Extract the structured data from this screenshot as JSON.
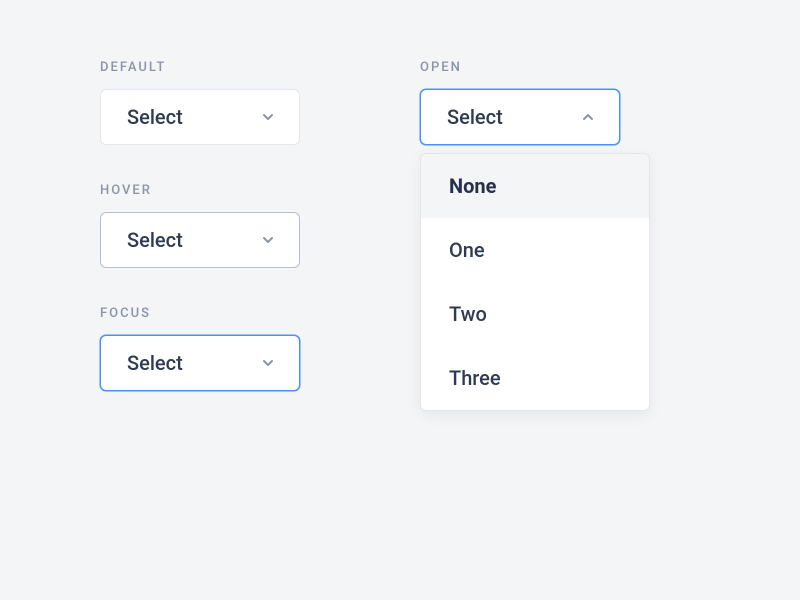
{
  "left": {
    "default": {
      "label": "DEFAULT",
      "text": "Select"
    },
    "hover": {
      "label": "HOVER",
      "text": "Select"
    },
    "focus": {
      "label": "FOCUS",
      "text": "Select"
    }
  },
  "right": {
    "open": {
      "label": "OPEN",
      "text": "Select",
      "options": [
        "None",
        "One",
        "Two",
        "Three"
      ],
      "selected_index": 0
    }
  }
}
